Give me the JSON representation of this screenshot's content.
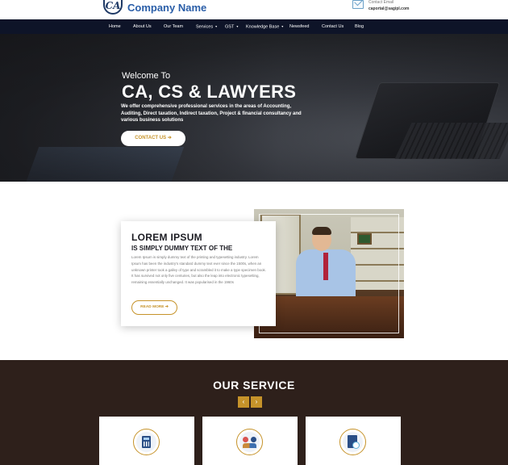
{
  "header": {
    "logo_text": "CA",
    "company_name": "Company Name",
    "email_label": "Contact Email",
    "email_value": "caportal@sagipl.com"
  },
  "nav": {
    "items": [
      {
        "label": "Home"
      },
      {
        "label": "About Us"
      },
      {
        "label": "Our Team"
      },
      {
        "label": "Services",
        "has_dropdown": true
      },
      {
        "label": "GST",
        "has_dropdown": true
      },
      {
        "label": "Knowledge Base",
        "has_dropdown": true
      },
      {
        "label": "Newsfeed"
      },
      {
        "label": "Contact Us"
      },
      {
        "label": "Blog"
      }
    ]
  },
  "hero": {
    "welcome": "Welcome To",
    "title": "CA, CS & LAWYERS",
    "description": "We offer comprehensive professional services in the areas of Accounting, Auditing, Direct taxation, Indirect taxation, Project & financial consultancy and various business solutions",
    "button_label": "CONTACT US ➔"
  },
  "about": {
    "title": "LOREM IPSUM",
    "subtitle": "IS SIMPLY DUMMY TEXT OF THE",
    "body": "Lorem Ipsum is simply dummy text of the printing and typesetting industry. Lorem Ipsum has been the industry's standard dummy text ever since the 1500s, when an unknown printer took a galley of type and scrambled it to make a type specimen book. It has survived not only five centuries, but also the leap into electronic typesetting, remaining essentially unchanged. It was popularised in the 1960s",
    "button_label": "READ MORE ➔"
  },
  "services": {
    "title": "OUR SERVICE",
    "prev_label": "‹",
    "next_label": "›",
    "cards": [
      {
        "icon": "calculator-icon"
      },
      {
        "icon": "meeting-icon"
      },
      {
        "icon": "document-search-icon"
      }
    ]
  },
  "colors": {
    "nav_bg": "#0e1428",
    "accent": "#c6932a",
    "brand": "#2a5ea8",
    "services_bg": "#2e201b"
  }
}
